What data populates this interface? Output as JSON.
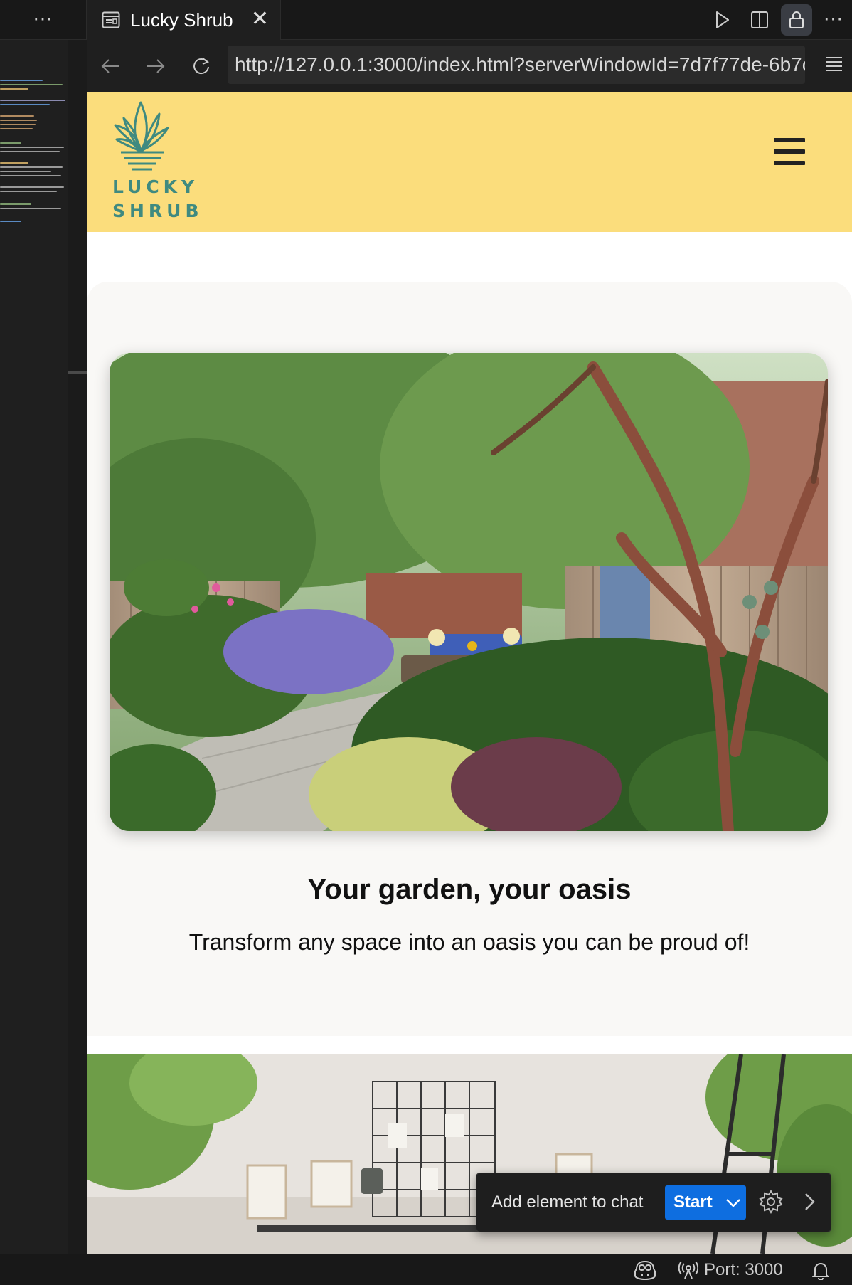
{
  "editor": {
    "more_label": "···"
  },
  "browser": {
    "tab": {
      "title": "Lucky Shrub",
      "close_glyph": "✕"
    },
    "more_label": "···",
    "url": "http://127.0.0.1:3000/index.html?serverWindowId=7d7f77de-6b7c"
  },
  "site": {
    "logo": {
      "line1": "LUCKY",
      "line2": "SHRUB"
    },
    "hero": {
      "title": "Your garden, your oasis",
      "subtitle": "Transform any space into an oasis you can be proud of!"
    }
  },
  "chat_toolbar": {
    "label": "Add element to chat",
    "start_label": "Start"
  },
  "statusbar": {
    "port_label": "Port: 3000"
  },
  "colors": {
    "header_yellow": "#fbdd7c",
    "logo_teal": "#3f8a80",
    "accent_blue": "#0e6ee0",
    "card_bg": "#f9f8f6"
  }
}
